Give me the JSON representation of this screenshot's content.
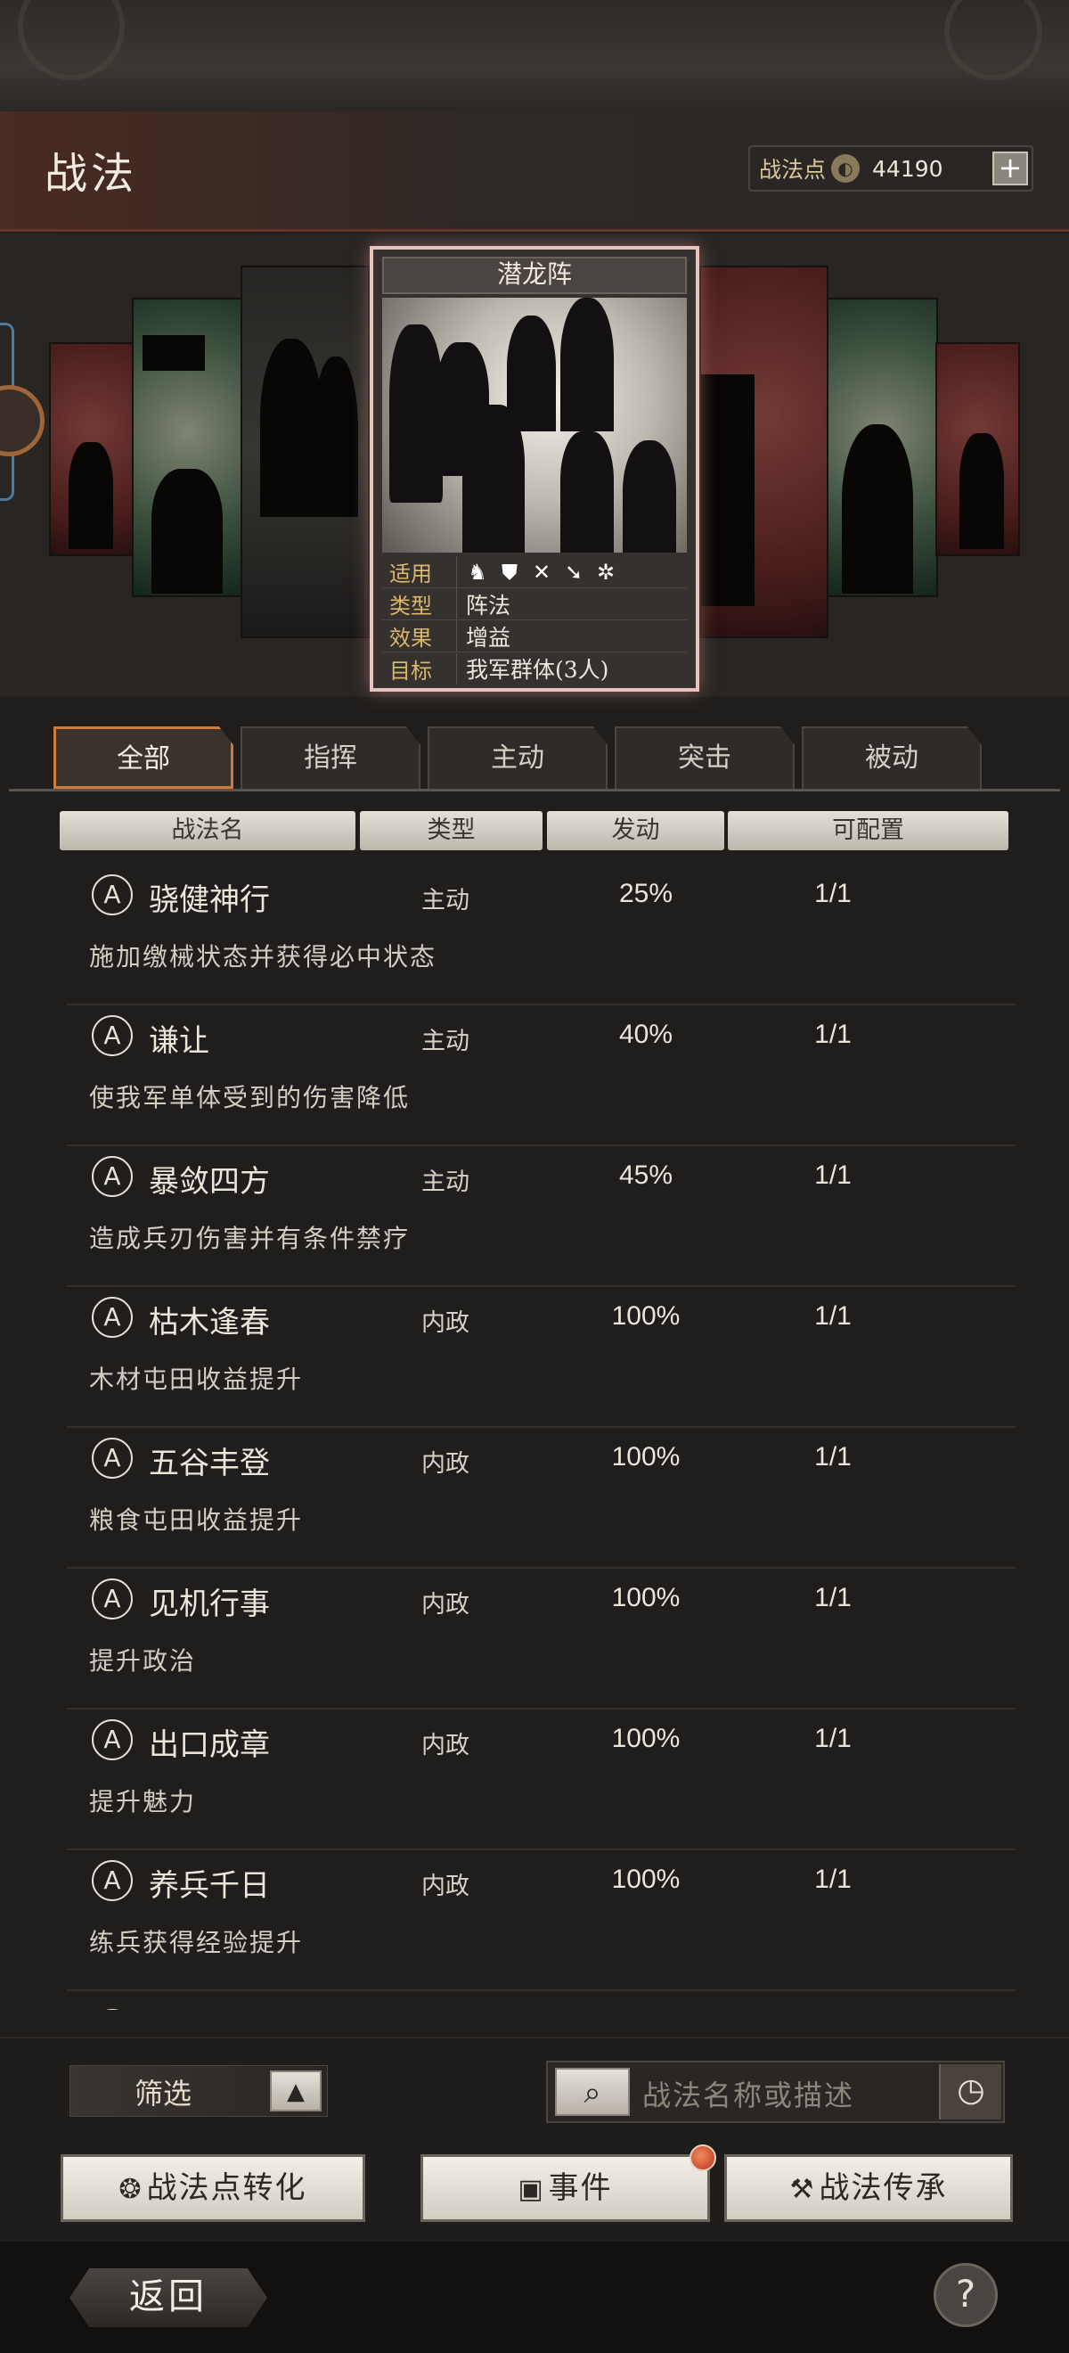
{
  "header": {
    "title": "战法",
    "points_label": "战法点",
    "points_value": "44190",
    "plus_label": "+"
  },
  "featured_card": {
    "name": "潜龙阵",
    "rows": [
      {
        "key": "适用",
        "value": ""
      },
      {
        "key": "类型",
        "value": "阵法"
      },
      {
        "key": "效果",
        "value": "增益"
      },
      {
        "key": "目标",
        "value": "我军群体(3人)"
      }
    ],
    "troop_icons": [
      "cavalry-icon",
      "shield-icon",
      "bow-icon",
      "spear-icon",
      "wheel-icon"
    ]
  },
  "tabs": [
    "全部",
    "指挥",
    "主动",
    "突击",
    "被动"
  ],
  "active_tab": "全部",
  "columns": [
    "战法名",
    "类型",
    "发动",
    "可配置"
  ],
  "items": [
    {
      "grade": "A",
      "name": "骁健神行",
      "type": "主动",
      "rate": "25%",
      "config": "1/1",
      "desc": "施加缴械状态并获得必中状态"
    },
    {
      "grade": "A",
      "name": "谦让",
      "type": "主动",
      "rate": "40%",
      "config": "1/1",
      "desc": "使我军单体受到的伤害降低"
    },
    {
      "grade": "A",
      "name": "暴敛四方",
      "type": "主动",
      "rate": "45%",
      "config": "1/1",
      "desc": "造成兵刃伤害并有条件禁疗"
    },
    {
      "grade": "A",
      "name": "枯木逢春",
      "type": "内政",
      "rate": "100%",
      "config": "1/1",
      "desc": "木材屯田收益提升"
    },
    {
      "grade": "A",
      "name": "五谷丰登",
      "type": "内政",
      "rate": "100%",
      "config": "1/1",
      "desc": "粮食屯田收益提升"
    },
    {
      "grade": "A",
      "name": "见机行事",
      "type": "内政",
      "rate": "100%",
      "config": "1/1",
      "desc": "提升政治"
    },
    {
      "grade": "A",
      "name": "出口成章",
      "type": "内政",
      "rate": "100%",
      "config": "1/1",
      "desc": "提升魅力"
    },
    {
      "grade": "A",
      "name": "养兵千日",
      "type": "内政",
      "rate": "100%",
      "config": "1/1",
      "desc": "练兵获得经验提升"
    }
  ],
  "bottom": {
    "filter_label": "筛选",
    "search_placeholder": "战法名称或描述",
    "convert_label": "战法点转化",
    "event_label": "事件",
    "inherit_label": "战法传承"
  },
  "nav": {
    "back_label": "返回",
    "help_label": "?"
  },
  "colors": {
    "accent": "#d07a3a",
    "card_border": "#e8c2bc",
    "notification": "#c84a2a"
  }
}
